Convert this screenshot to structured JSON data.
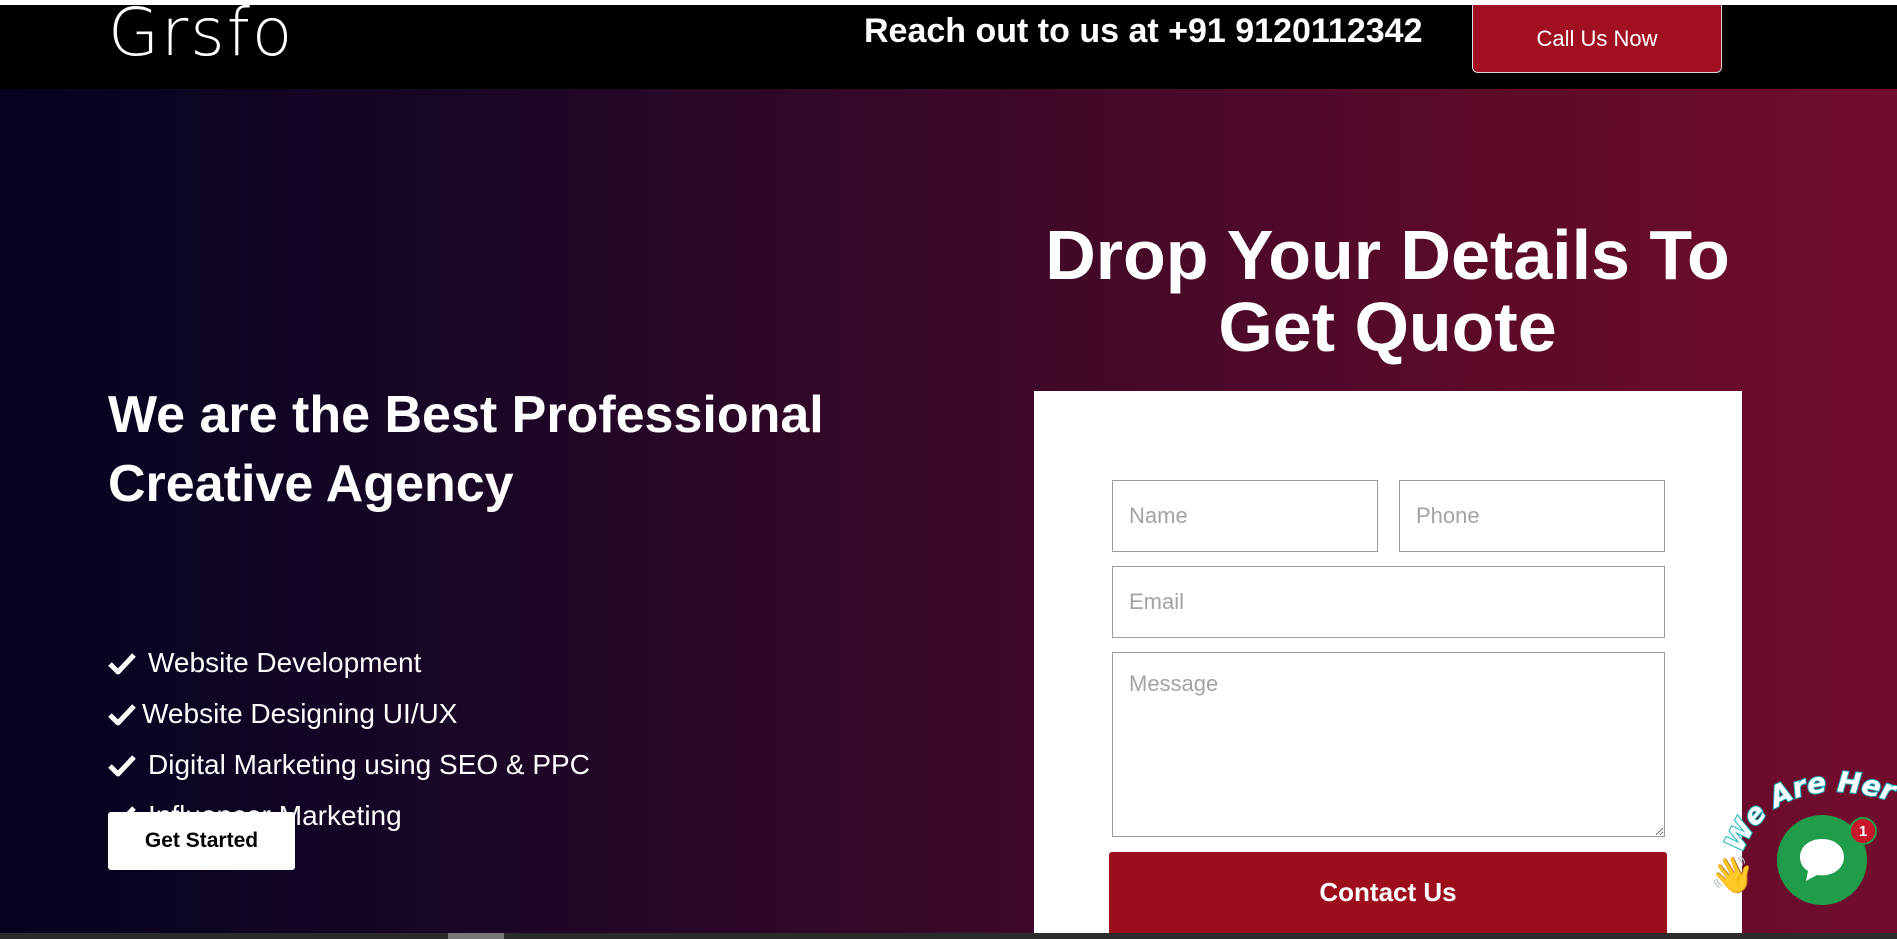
{
  "header": {
    "logo_text": "Grsfo",
    "reach_text": "Reach out to us at +91 9120112342",
    "call_button_label": "Call Us Now"
  },
  "hero": {
    "headline": "We are the Best Professional Creative Agency",
    "features": [
      "Website Development",
      "Website Designing UI/UX",
      "Digital Marketing using SEO & PPC",
      "Influencer Marketing"
    ],
    "cta_label": "Get Started"
  },
  "form": {
    "title": "Drop Your Details To Get Quote",
    "name_placeholder": "Name",
    "phone_placeholder": "Phone",
    "email_placeholder": "Email",
    "message_placeholder": "Message",
    "submit_label": "Contact Us"
  },
  "chat_widget": {
    "tagline": "We Are Here!",
    "unread_count": "1",
    "icon": "chat-bubble-icon"
  },
  "colors": {
    "accent_red": "#a01020",
    "chat_green": "#1f9d4a",
    "badge_red": "#c8162b"
  }
}
